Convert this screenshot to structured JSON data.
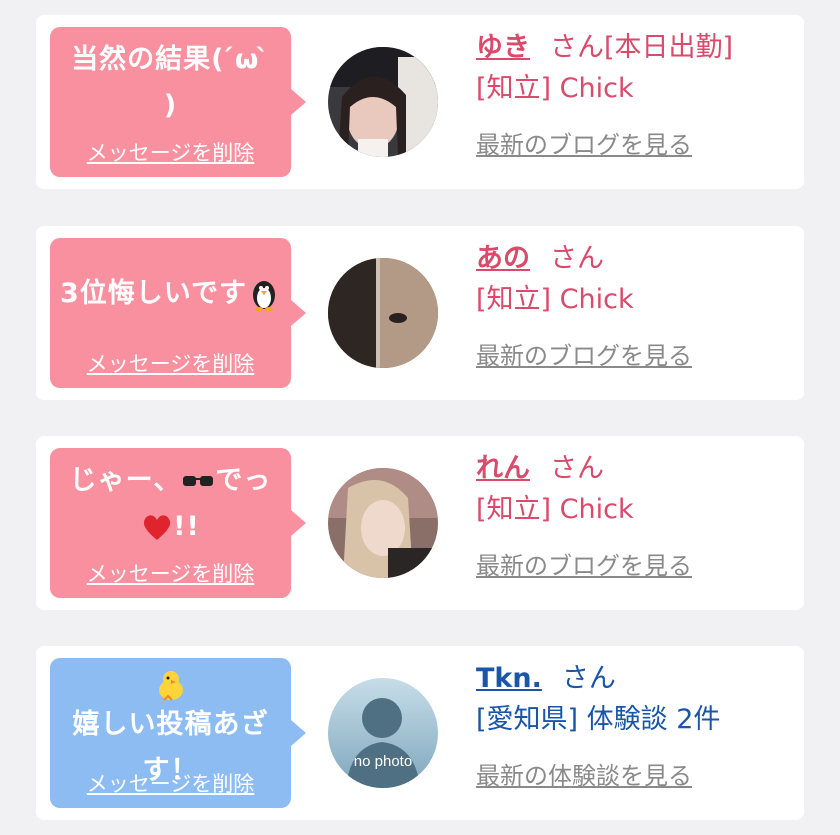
{
  "posts": [
    {
      "message": "当然の結果(  ́ω ̀ )",
      "delete_label": "メッセージを削除",
      "name": "ゆき",
      "honorific": "さん[本日出勤]",
      "area": "[知立] Chick",
      "link": "最新のブログを見る",
      "bubble_color": "#f8909f",
      "text_color": "#d94a6b"
    },
    {
      "message": "3位悔しいです",
      "emoji": "penguin",
      "delete_label": "メッセージを削除",
      "name": "あの",
      "honorific": "さん",
      "area": "[知立] Chick",
      "link": "最新のブログを見る",
      "bubble_color": "#f8909f",
      "text_color": "#d94a6b"
    },
    {
      "message_part1": "じゃー、",
      "emoji1": "sunglasses",
      "message_part2": "でっ",
      "emoji2": "red-heart",
      "message_part3": "!!",
      "delete_label": "メッセージを削除",
      "name": "れん",
      "honorific": "さん",
      "area": "[知立] Chick",
      "link": "最新のブログを見る",
      "bubble_color": "#f8909f",
      "text_color": "#d94a6b"
    },
    {
      "emoji": "baby-chick",
      "message": "嬉しい投稿あざす！",
      "delete_label": "メッセージを削除",
      "name": "Tkn.",
      "honorific": "さん",
      "area": "[愛知県] 体験談 2件",
      "link": "最新の体験談を見る",
      "avatar_text": "no photo",
      "bubble_color": "#8dbcf2",
      "text_color": "#1a56a8"
    }
  ]
}
